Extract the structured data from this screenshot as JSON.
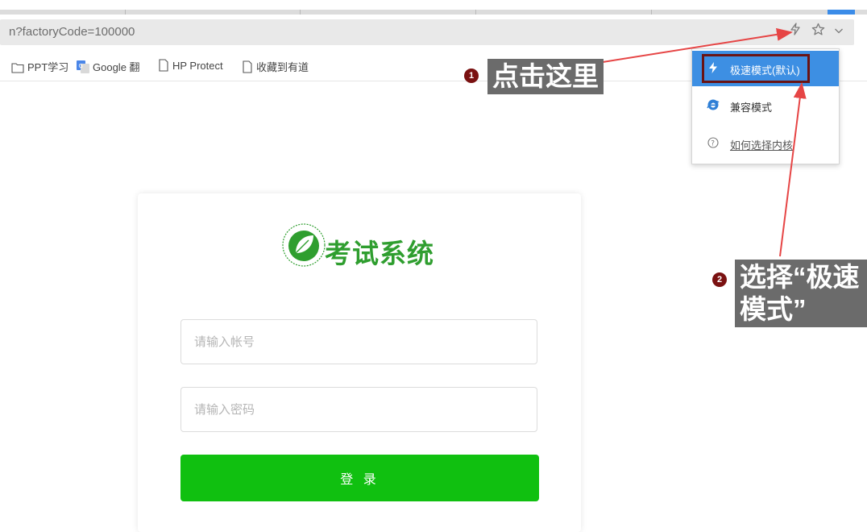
{
  "address_bar": {
    "url": "n?factoryCode=100000",
    "icons": [
      "lightning-icon",
      "star-icon",
      "chevron-down-icon"
    ]
  },
  "bookmarks": [
    {
      "label": "PPT学习",
      "icon": "folder-icon"
    },
    {
      "label": "Google 翻",
      "icon": "google-translate-icon"
    },
    {
      "label": "HP Protect",
      "icon": "page-icon"
    },
    {
      "label": "收藏到有道",
      "icon": "page-icon"
    }
  ],
  "mode_menu": {
    "items": [
      {
        "label": "极速模式(默认)",
        "icon": "lightning-icon",
        "selected": true
      },
      {
        "label": "兼容模式",
        "icon": "ie-icon",
        "selected": false
      },
      {
        "label": "如何选择内核",
        "icon": "help-icon",
        "selected": false
      }
    ]
  },
  "login": {
    "title": "考试系统",
    "logo": "leaf-logo",
    "account_placeholder": "请输入帐号",
    "password_placeholder": "请输入密码",
    "login_label": "登 录"
  },
  "annotations": {
    "step1_num": "1",
    "step1_text": "点击这里",
    "step2_num": "2",
    "step2_text_line1": "选择“极速",
    "step2_text_line2": "模式”"
  },
  "colors": {
    "menu_selected": "#3d8fe3",
    "highlight_border": "#6a1313",
    "login_button": "#10c010",
    "brand_green": "#2f9e2f",
    "arrow_red": "#e64545",
    "callout_bg": "#6b6b6b"
  }
}
